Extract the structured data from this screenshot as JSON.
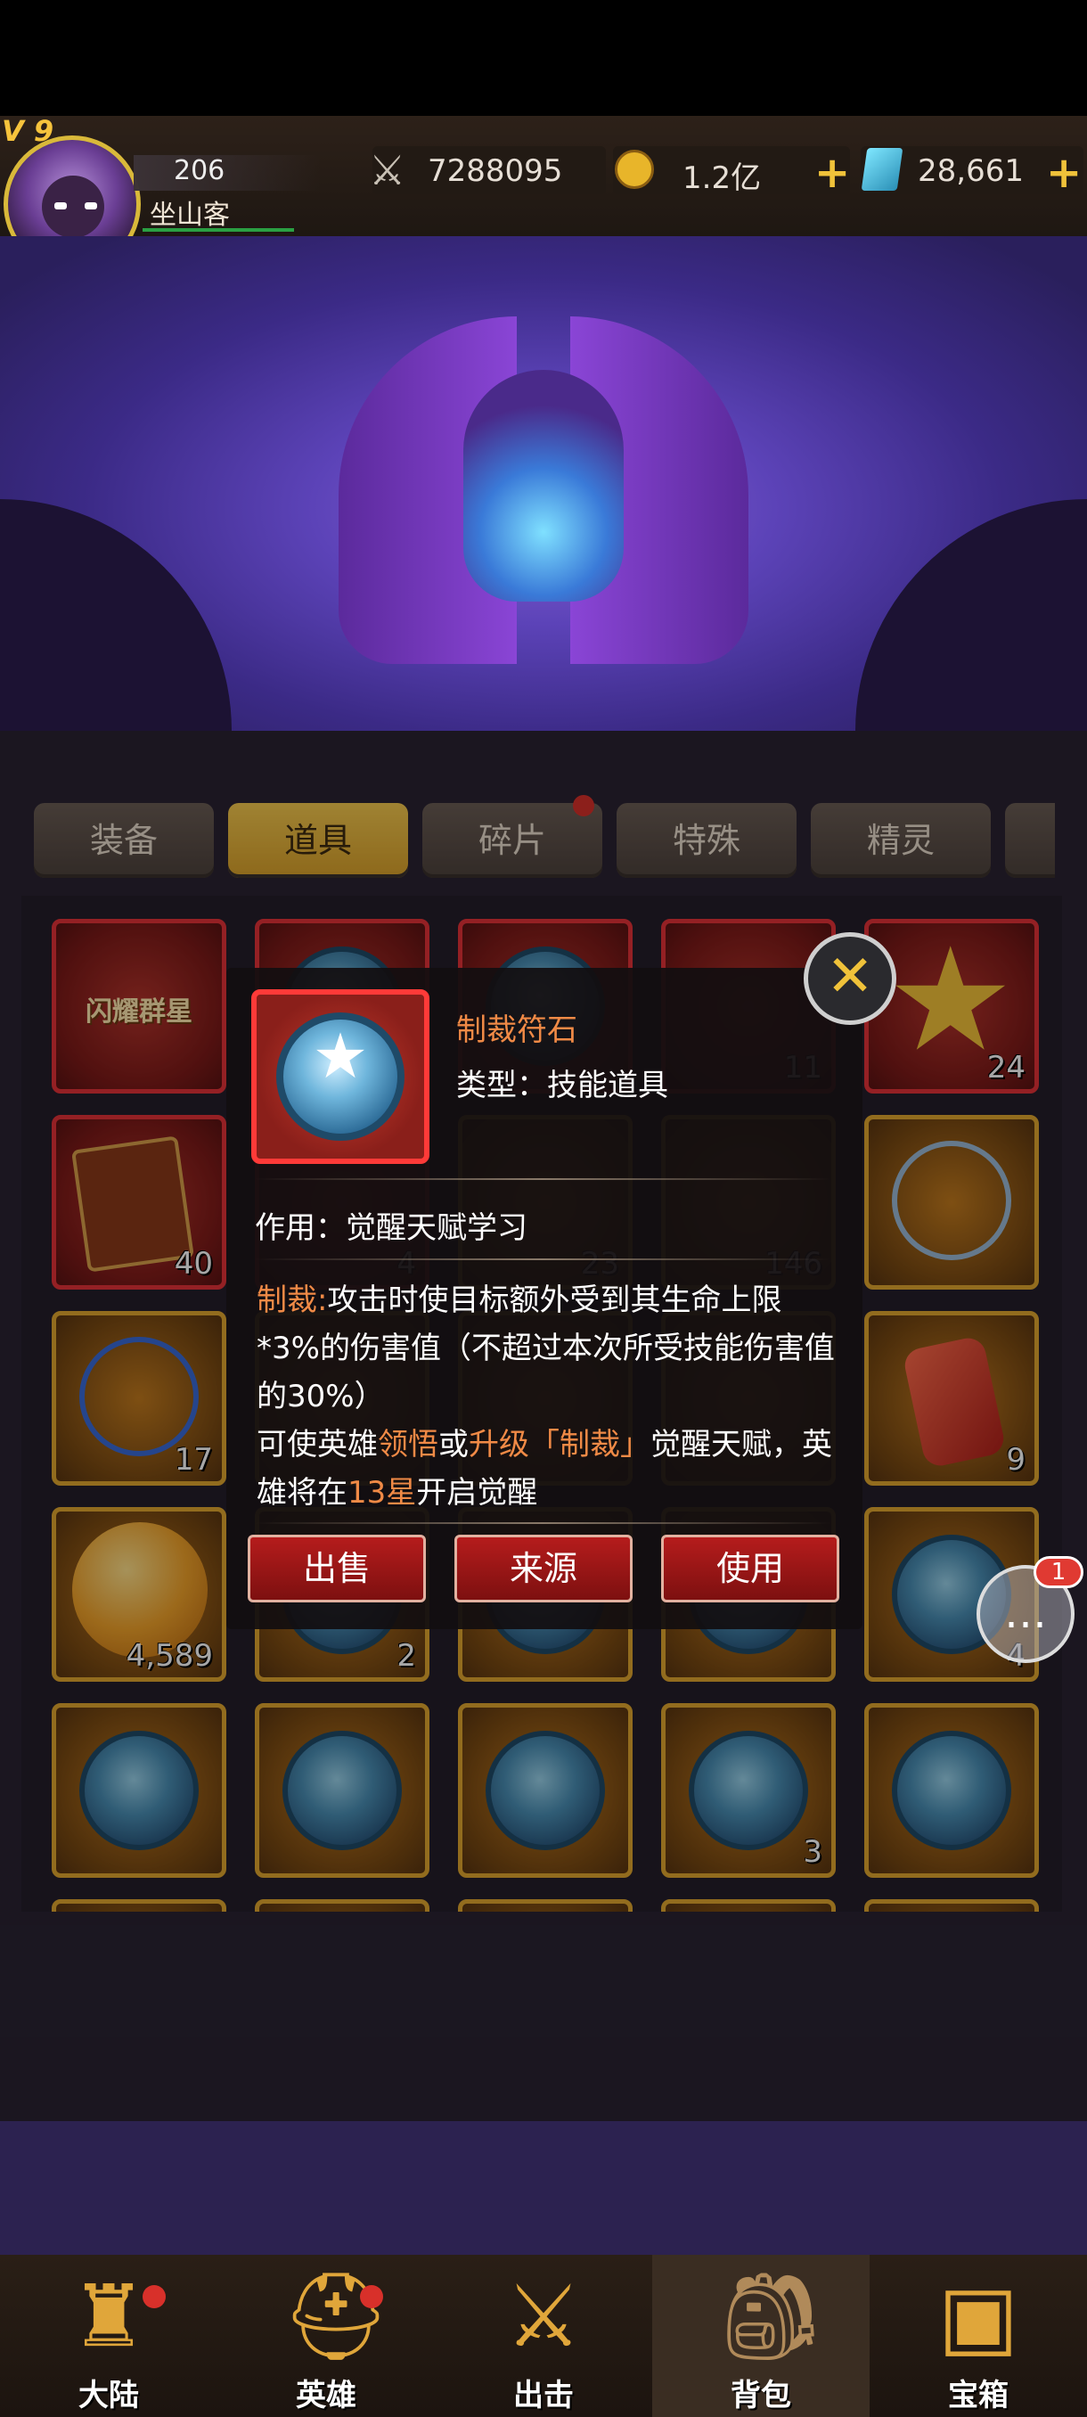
{
  "player": {
    "vip": "V 9",
    "level": "206",
    "name": "坐山客"
  },
  "resources": {
    "power": "7288095",
    "gold": "1.2亿",
    "gems": "28,661",
    "plus": "+"
  },
  "tabs": [
    "装备",
    "道具",
    "碎片",
    "特殊",
    "精灵"
  ],
  "grid_counts": {
    "r1c4": "11",
    "r1c5": "24",
    "r2c1": "40",
    "r2c2": "4",
    "r2c3": "23",
    "r2c4": "146",
    "r3c1": "17",
    "r3c5": "9",
    "r4c1": "4,589",
    "r4c2": "2",
    "r4c5": "4",
    "r5c4": "3"
  },
  "banner_text": "闪耀群星",
  "popup": {
    "name": "制裁符石",
    "type_line": "类型：技能道具",
    "use_line": "作用：觉醒天赋学习",
    "desc_label": "制裁:",
    "desc_1": "攻击时使目标额外受到其生命上限*3%的伤害值（不超过本次所受技能伤害值的30%）",
    "desc_2a": "可使英雄",
    "desc_2b": "领悟",
    "desc_2c": "或",
    "desc_2d": "升级「制裁」",
    "desc_2e": "觉醒天赋，英雄将在",
    "desc_2f": "13星",
    "desc_2g": "开启觉醒",
    "buttons": {
      "sell": "出售",
      "source": "来源",
      "use": "使用"
    },
    "close": "✕"
  },
  "chat": {
    "badge": "1"
  },
  "nav": [
    "大陆",
    "英雄",
    "出击",
    "背包",
    "宝箱"
  ],
  "colors": {
    "accent": "#f0c23a",
    "highlight": "#f08a46",
    "button_red": "#b51c1c"
  }
}
